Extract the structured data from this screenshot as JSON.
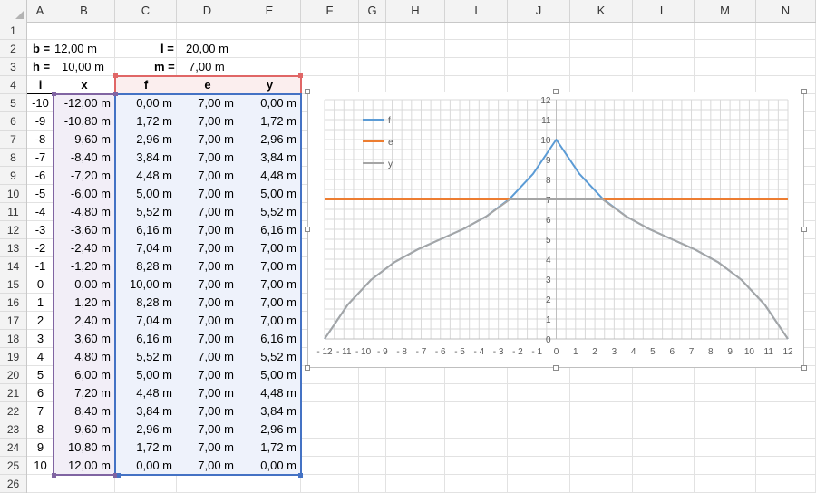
{
  "columns": [
    "A",
    "B",
    "C",
    "D",
    "E",
    "F",
    "G",
    "H",
    "I",
    "J",
    "K",
    "L",
    "M",
    "N"
  ],
  "rows": [
    "1",
    "2",
    "3",
    "4",
    "5",
    "6",
    "7",
    "8",
    "9",
    "10",
    "11",
    "12",
    "13",
    "14",
    "15",
    "16",
    "17",
    "18",
    "19",
    "20",
    "21",
    "22",
    "23",
    "24",
    "25",
    "26"
  ],
  "params": {
    "b_label": "b =",
    "b_value": "12,00 m",
    "l_label": "l =",
    "l_value": "20,00 m",
    "h_label": "h =",
    "h_value": "10,00 m",
    "m_label": "m =",
    "m_value": "7,00 m"
  },
  "table": {
    "headers": [
      "i",
      "x",
      "f",
      "e",
      "y"
    ],
    "rows": [
      [
        "-10",
        "-12,00 m",
        "0,00 m",
        "7,00 m",
        "0,00 m"
      ],
      [
        "-9",
        "-10,80 m",
        "1,72 m",
        "7,00 m",
        "1,72 m"
      ],
      [
        "-8",
        "-9,60 m",
        "2,96 m",
        "7,00 m",
        "2,96 m"
      ],
      [
        "-7",
        "-8,40 m",
        "3,84 m",
        "7,00 m",
        "3,84 m"
      ],
      [
        "-6",
        "-7,20 m",
        "4,48 m",
        "7,00 m",
        "4,48 m"
      ],
      [
        "-5",
        "-6,00 m",
        "5,00 m",
        "7,00 m",
        "5,00 m"
      ],
      [
        "-4",
        "-4,80 m",
        "5,52 m",
        "7,00 m",
        "5,52 m"
      ],
      [
        "-3",
        "-3,60 m",
        "6,16 m",
        "7,00 m",
        "6,16 m"
      ],
      [
        "-2",
        "-2,40 m",
        "7,04 m",
        "7,00 m",
        "7,00 m"
      ],
      [
        "-1",
        "-1,20 m",
        "8,28 m",
        "7,00 m",
        "7,00 m"
      ],
      [
        "0",
        "0,00 m",
        "10,00 m",
        "7,00 m",
        "7,00 m"
      ],
      [
        "1",
        "1,20 m",
        "8,28 m",
        "7,00 m",
        "7,00 m"
      ],
      [
        "2",
        "2,40 m",
        "7,04 m",
        "7,00 m",
        "7,00 m"
      ],
      [
        "3",
        "3,60 m",
        "6,16 m",
        "7,00 m",
        "6,16 m"
      ],
      [
        "4",
        "4,80 m",
        "5,52 m",
        "7,00 m",
        "5,52 m"
      ],
      [
        "5",
        "6,00 m",
        "5,00 m",
        "7,00 m",
        "5,00 m"
      ],
      [
        "6",
        "7,20 m",
        "4,48 m",
        "7,00 m",
        "4,48 m"
      ],
      [
        "7",
        "8,40 m",
        "3,84 m",
        "7,00 m",
        "3,84 m"
      ],
      [
        "8",
        "9,60 m",
        "2,96 m",
        "7,00 m",
        "2,96 m"
      ],
      [
        "9",
        "10,80 m",
        "1,72 m",
        "7,00 m",
        "1,72 m"
      ],
      [
        "10",
        "12,00 m",
        "0,00 m",
        "7,00 m",
        "0,00 m"
      ]
    ]
  },
  "colors": {
    "f": "#5b9bd5",
    "e": "#ed7d31",
    "y": "#a5a5a5",
    "purple": "#8064a2",
    "red": "#e06666",
    "blue": "#4472c4"
  },
  "chart_data": {
    "type": "line",
    "xlim": [
      -12,
      12
    ],
    "ylim": [
      0,
      12
    ],
    "xticks": [
      -12,
      -11,
      -10,
      -9,
      -8,
      -7,
      -6,
      -5,
      -4,
      -3,
      -2,
      -1,
      0,
      1,
      2,
      3,
      4,
      5,
      6,
      7,
      8,
      9,
      10,
      11,
      12
    ],
    "yticks": [
      0,
      1,
      2,
      3,
      4,
      5,
      6,
      7,
      8,
      9,
      10,
      11,
      12
    ],
    "grid": true,
    "legend_position": "top-left",
    "x": [
      -12,
      -10.8,
      -9.6,
      -8.4,
      -7.2,
      -6,
      -4.8,
      -3.6,
      -2.4,
      -1.2,
      0,
      1.2,
      2.4,
      3.6,
      4.8,
      6,
      7.2,
      8.4,
      9.6,
      10.8,
      12
    ],
    "series": [
      {
        "name": "f",
        "color": "#5b9bd5",
        "values": [
          0,
          1.72,
          2.96,
          3.84,
          4.48,
          5,
          5.52,
          6.16,
          7.04,
          8.28,
          10,
          8.28,
          7.04,
          6.16,
          5.52,
          5,
          4.48,
          3.84,
          2.96,
          1.72,
          0
        ]
      },
      {
        "name": "e",
        "color": "#ed7d31",
        "values": [
          7,
          7,
          7,
          7,
          7,
          7,
          7,
          7,
          7,
          7,
          7,
          7,
          7,
          7,
          7,
          7,
          7,
          7,
          7,
          7,
          7
        ]
      },
      {
        "name": "y",
        "color": "#a5a5a5",
        "values": [
          0,
          1.72,
          2.96,
          3.84,
          4.48,
          5,
          5.52,
          6.16,
          7,
          7,
          7,
          7,
          7,
          6.16,
          5.52,
          5,
          4.48,
          3.84,
          2.96,
          1.72,
          0
        ]
      }
    ]
  }
}
